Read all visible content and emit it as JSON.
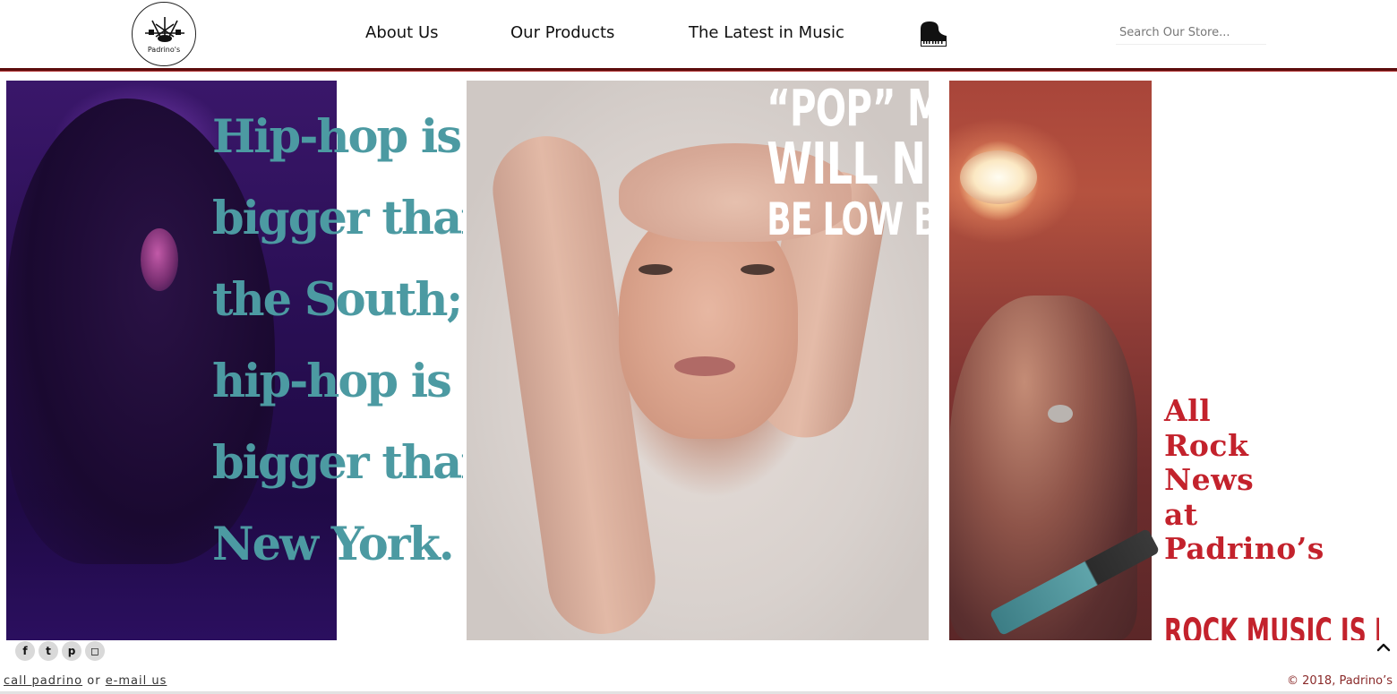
{
  "header": {
    "logo_text": "Padrino's",
    "nav": {
      "about": "About Us",
      "products": "Our Products",
      "latest": "The Latest in Music"
    },
    "piano_icon": "piano-icon",
    "search": {
      "placeholder": "Search Our Store...",
      "value": ""
    }
  },
  "panels": {
    "hiphop": {
      "lines": [
        "Hip-hop is",
        "bigger than",
        "the South;",
        "hip-hop is",
        "bigger than",
        "New York."
      ],
      "color": "#4c9aa2"
    },
    "pop": {
      "lines": [
        "“POP” MUSIC",
        "WILL NEVER",
        "BE LOW BROW"
      ],
      "color": "#ffffff"
    },
    "rock": {
      "headline": [
        "All",
        "Rock",
        "News",
        "at",
        "Padrino’s"
      ],
      "subhead": "ROCK MUSIC IS NOT",
      "color": "#c3222c"
    }
  },
  "footer": {
    "social": [
      {
        "icon": "facebook-icon",
        "glyph": "f"
      },
      {
        "icon": "twitter-icon",
        "glyph": "t"
      },
      {
        "icon": "pinterest-icon",
        "glyph": "p"
      },
      {
        "icon": "instagram-icon",
        "glyph": "◻"
      }
    ],
    "call_link": "call padrino",
    "or_text": "or",
    "email_link": "e-mail us",
    "copyright": "© 2018, Padrino’s",
    "back_to_top_icon": "chevron-up-icon"
  },
  "colors": {
    "accent_rule": "#5c0d0d",
    "hiphop_teal": "#4c9aa2",
    "rock_red": "#c3222c"
  }
}
